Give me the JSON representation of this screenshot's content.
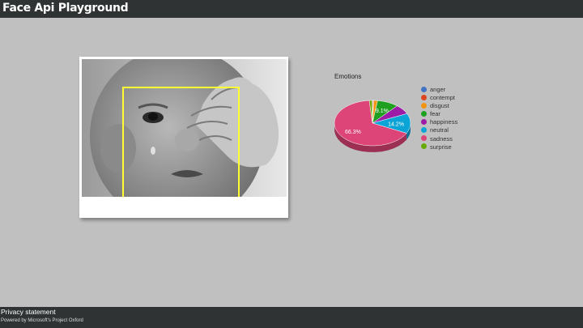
{
  "header": {
    "title": "Face Api Playground"
  },
  "photo": {
    "description_icon": "crying-baby-photo",
    "face_box_color": "#ffff33"
  },
  "chart_data": {
    "type": "pie",
    "title": "Emotions",
    "legend_position": "right",
    "categories": [
      "anger",
      "contempt",
      "disgust",
      "fear",
      "happiness",
      "neutral",
      "sadness",
      "surprise"
    ],
    "values": [
      0.3,
      0.4,
      1.6,
      9.1,
      6.9,
      14.2,
      66.3,
      1.2
    ],
    "colors": [
      "#4472c4",
      "#dc4520",
      "#f29410",
      "#20a020",
      "#9c1ca8",
      "#0ba4d6",
      "#dd4477",
      "#66aa00"
    ],
    "data_labels": {
      "fear": "9.1%",
      "neutral": "14.2%",
      "sadness": "66.3%"
    }
  },
  "footer": {
    "privacy": "Privacy statement",
    "powered_by": "Powered by Microsoft's Project Oxford"
  }
}
